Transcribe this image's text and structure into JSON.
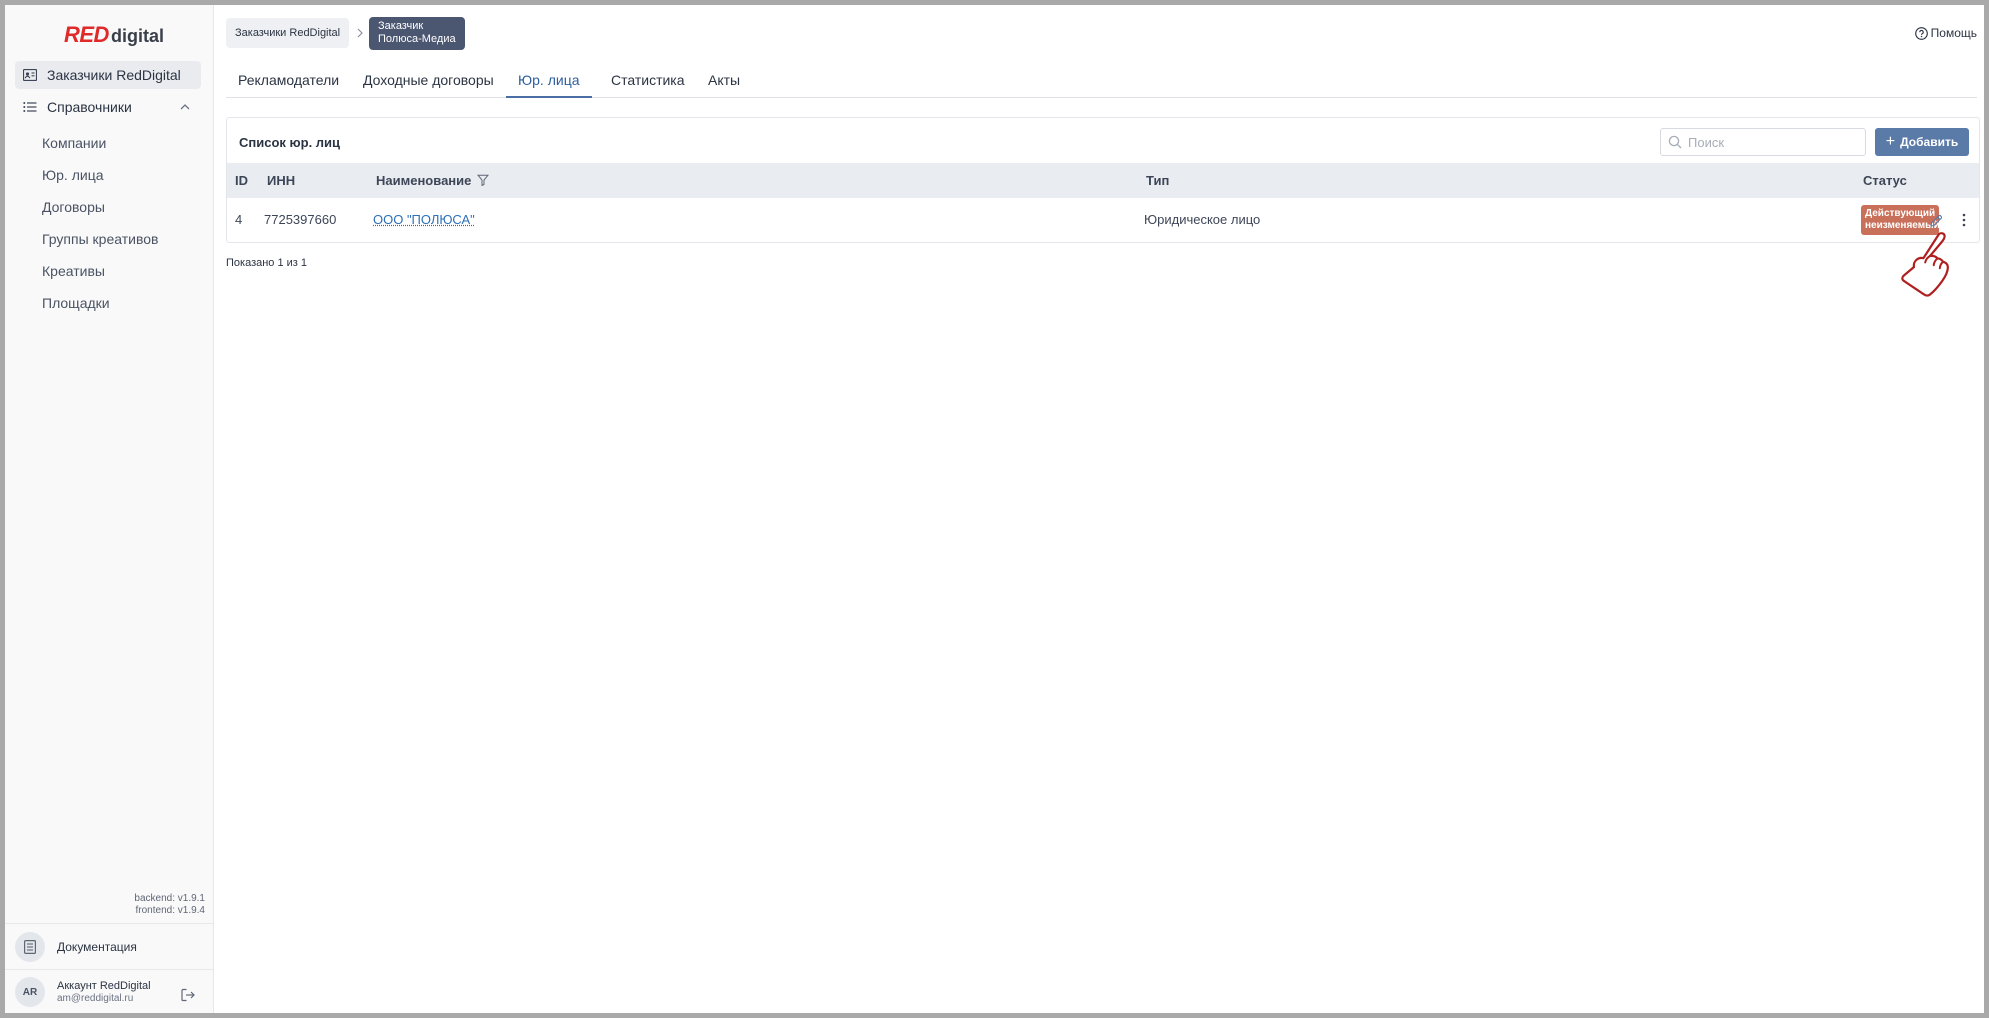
{
  "logo": {
    "red": "RED",
    "digital": "digital"
  },
  "sidebar": {
    "customers_label": "Заказчики RedDigital",
    "directories_label": "Справочники",
    "sub_items": [
      {
        "label": "Компании"
      },
      {
        "label": "Юр. лица"
      },
      {
        "label": "Договоры"
      },
      {
        "label": "Группы креативов"
      },
      {
        "label": "Креативы"
      },
      {
        "label": "Площадки"
      }
    ],
    "versions": {
      "backend": "backend: v1.9.1",
      "frontend": "frontend: v1.9.4"
    },
    "docs_label": "Документация",
    "account": {
      "initials": "AR",
      "name": "Аккаунт RedDigital",
      "email": "am@reddigital.ru"
    }
  },
  "header": {
    "breadcrumb_root": "Заказчики RedDigital",
    "breadcrumb_current_line1": "Заказчик",
    "breadcrumb_current_line2": "Полюса-Медиа",
    "help_label": "Помощь"
  },
  "tabs": [
    {
      "label": "Рекламодатели",
      "active": false
    },
    {
      "label": "Доходные договоры",
      "active": false
    },
    {
      "label": "Юр. лица",
      "active": true
    },
    {
      "label": "Статистика",
      "active": false
    },
    {
      "label": "Акты",
      "active": false
    }
  ],
  "card": {
    "title": "Список юр. лиц",
    "search_placeholder": "Поиск",
    "add_label": "Добавить",
    "columns": {
      "id": "ID",
      "inn": "ИНН",
      "name": "Наименование",
      "type": "Тип",
      "status": "Статус"
    },
    "rows": [
      {
        "id": "4",
        "inn": "7725397660",
        "name": "ООО \"ПОЛЮСА\"",
        "type": "Юридическое лицо",
        "status_line1": "Действующий",
        "status_line2": "неизменяемый"
      }
    ],
    "footer": "Показано 1 из 1"
  },
  "colors": {
    "accent": "#5a7aa8",
    "tab_active": "#2d5d9e",
    "badge": "#c8705a",
    "logo_red": "#e02a2a"
  },
  "icons": [
    "customers-icon",
    "list-icon",
    "chevron-up-icon",
    "document-icon",
    "logout-icon",
    "help-icon",
    "chevron-right-icon",
    "search-icon",
    "plus-icon",
    "filter-icon",
    "edit-icon",
    "more-vertical-icon",
    "pointer-hand-icon"
  ]
}
